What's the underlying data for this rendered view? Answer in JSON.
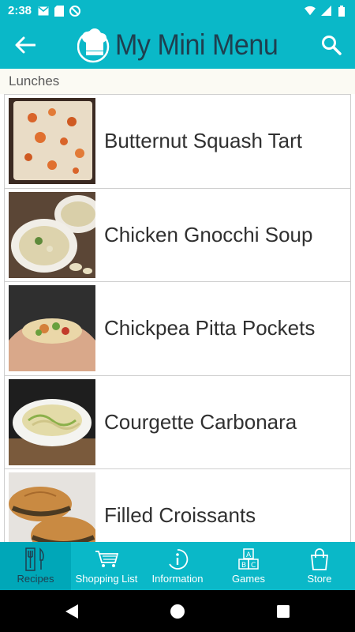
{
  "status_bar": {
    "time": "2:38",
    "left_icons": [
      "mail-icon",
      "sd-card-icon",
      "do-not-disturb-icon"
    ],
    "right_icons": [
      "wifi-icon",
      "signal-icon",
      "battery-icon"
    ]
  },
  "app_bar": {
    "title": "My Mini Menu",
    "back_icon": "arrow-back-icon",
    "search_icon": "search-icon",
    "colors": {
      "bar": "#0ab8c8",
      "title": "#1f3f4f"
    }
  },
  "section": {
    "title": "Lunches"
  },
  "recipes": [
    {
      "name": "Butternut Squash Tart",
      "thumb": "butternut-squash-tart-photo"
    },
    {
      "name": "Chicken Gnocchi Soup",
      "thumb": "chicken-gnocchi-soup-photo"
    },
    {
      "name": "Chickpea Pitta Pockets",
      "thumb": "chickpea-pitta-pockets-photo"
    },
    {
      "name": "Courgette Carbonara",
      "thumb": "courgette-carbonara-photo"
    },
    {
      "name": "Filled Croissants",
      "thumb": "filled-croissants-photo"
    }
  ],
  "bottom_nav": [
    {
      "label": "Recipes",
      "icon": "fork-knife-icon",
      "active": true
    },
    {
      "label": "Shopping List",
      "icon": "shopping-cart-icon",
      "active": false
    },
    {
      "label": "Information",
      "icon": "info-icon",
      "active": false
    },
    {
      "label": "Games",
      "icon": "abc-blocks-icon",
      "active": false
    },
    {
      "label": "Store",
      "icon": "shopping-bag-icon",
      "active": false
    }
  ],
  "system_nav": [
    "back-triangle-icon",
    "home-circle-icon",
    "recents-square-icon"
  ]
}
